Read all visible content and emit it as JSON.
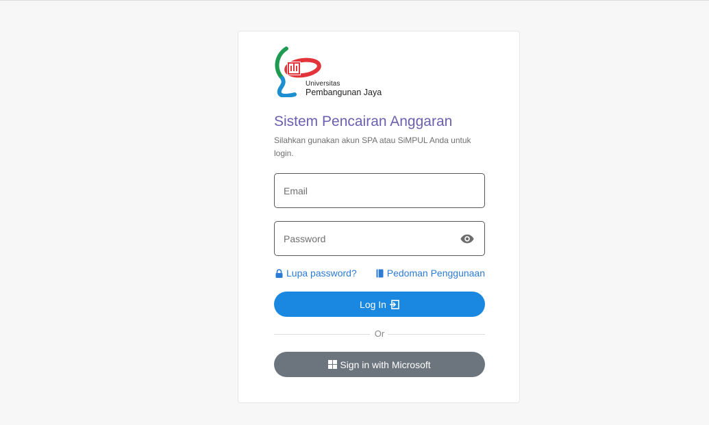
{
  "brand": {
    "logo_line1": "Universitas",
    "logo_line2": "Pembangunan Jaya",
    "colors": {
      "green": "#1f9a52",
      "red": "#e3343b",
      "blue": "#1b8fd0"
    }
  },
  "header": {
    "title": "Sistem Pencairan Anggaran",
    "subtitle": "Silahkan gunakan akun SPA atau SiMPUL Anda untuk login."
  },
  "form": {
    "email_placeholder": "Email",
    "email_value": "",
    "password_placeholder": "Password",
    "password_value": "",
    "forgot_label": "Lupa password?",
    "guide_label": "Pedoman Penggunaan",
    "login_label": "Log In",
    "divider_label": "Or",
    "microsoft_label": "Sign in with Microsoft"
  },
  "icons": {
    "eye": "eye-icon",
    "lock": "lock-icon",
    "book": "book-icon",
    "login": "login-arrow-icon",
    "microsoft": "windows-logo-icon"
  },
  "colors": {
    "accent": "#1a88e0",
    "title": "#6a5fb0",
    "link": "#2b7bd4",
    "secondary_button": "#6c757d"
  }
}
